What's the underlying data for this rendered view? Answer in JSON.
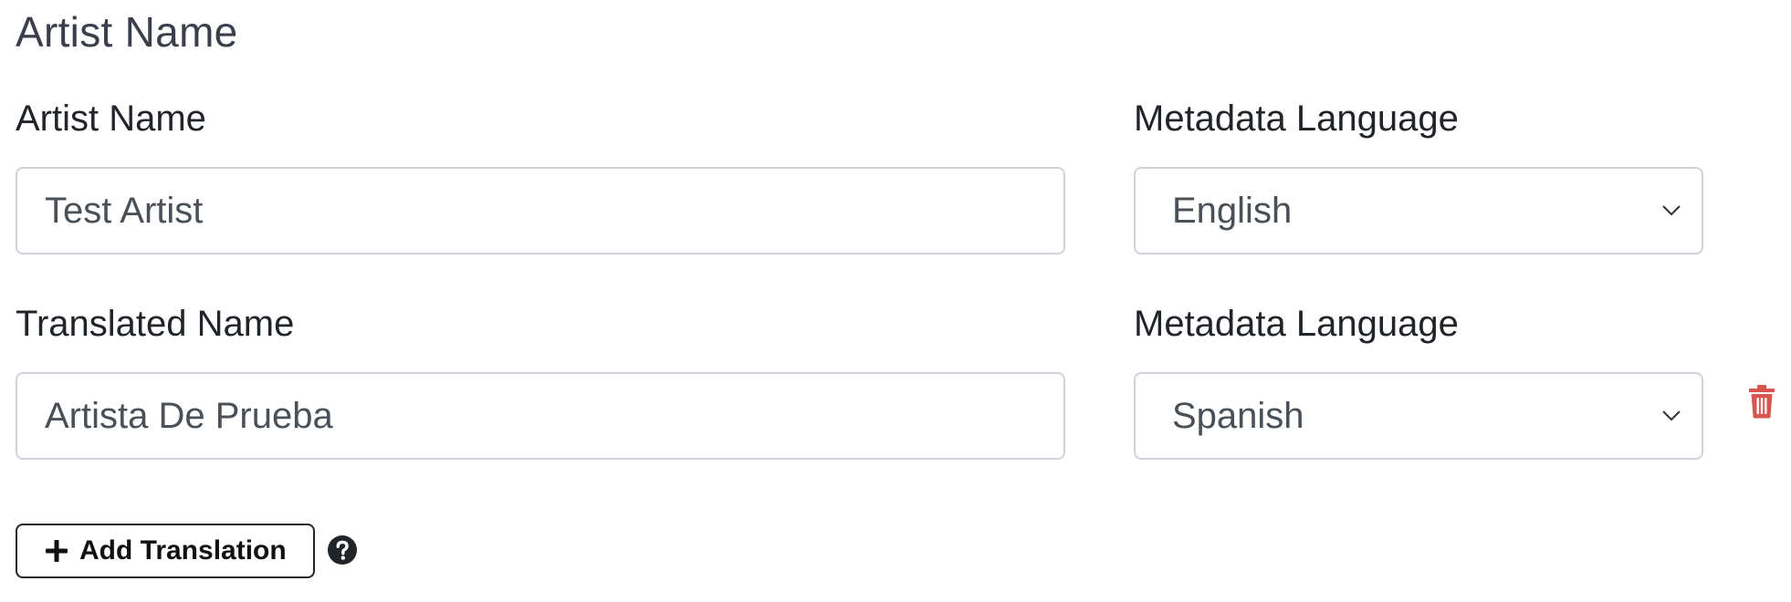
{
  "section": {
    "title": "Artist Name"
  },
  "primary": {
    "name_label": "Artist Name",
    "name_value": "Test Artist",
    "language_label": "Metadata Language",
    "language_value": "English"
  },
  "translation": {
    "name_label": "Translated Name",
    "name_value": "Artista De Prueba",
    "language_label": "Metadata Language",
    "language_value": "Spanish"
  },
  "actions": {
    "add_translation_label": "Add Translation",
    "add_icon": "plus-icon",
    "help_icon": "question-circle-icon",
    "delete_icon": "trash-icon"
  },
  "colors": {
    "danger": "#d9534f",
    "input_border": "#ced4da",
    "text": "#212529"
  }
}
